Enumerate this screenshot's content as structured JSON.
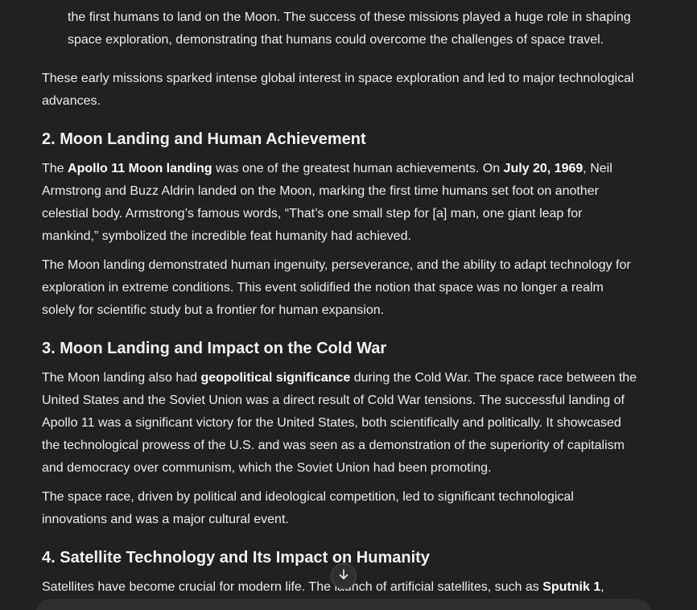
{
  "top": {
    "line1": "the first humans to land on the Moon. The success of these missions played a huge role in shaping",
    "line2": "space exploration, demonstrating that humans could overcome the challenges of space travel."
  },
  "intro_p": "These early missions sparked intense global interest in space exploration and led to major technological advances.",
  "s2": {
    "heading": "2. Moon Landing and Human Achievement",
    "p1": {
      "a": "The ",
      "b1": "Apollo 11 Moon landing",
      "c": " was one of the greatest human achievements. On ",
      "b2": "July 20, 1969",
      "d": ", Neil Armstrong and Buzz Aldrin landed on the Moon, marking the first time humans set foot on another celestial body. Armstrong’s famous words, “That’s one small step for [a] man, one giant leap for mankind,” symbolized the incredible feat humanity had achieved."
    },
    "p2": "The Moon landing demonstrated human ingenuity, perseverance, and the ability to adapt technology for exploration in extreme conditions. This event solidified the notion that space was no longer a realm solely for scientific study but a frontier for human expansion."
  },
  "s3": {
    "heading": "3. Moon Landing and Impact on the Cold War",
    "p1": {
      "a": "The Moon landing also had ",
      "b1": "geopolitical significance",
      "c": " during the Cold War. The space race between the United States and the Soviet Union was a direct result of Cold War tensions. The successful landing of Apollo 11 was a significant victory for the United States, both scientifically and politically. It showcased the technological prowess of the U.S. and was seen as a demonstration of the superiority of capitalism and democracy over communism, which the Soviet Union had been promoting."
    },
    "p2": "The space race, driven by political and ideological competition, led to significant technological innovations and was a major cultural event."
  },
  "s4": {
    "heading": "4. Satellite Technology and Its Impact on Humanity",
    "p1": {
      "a": "Satellites have become crucial for modern life. The launch of artificial satellites, such as ",
      "b1": "Sputnik 1",
      "c": ","
    }
  },
  "icons": {
    "scroll_down": "arrow-down-icon"
  }
}
